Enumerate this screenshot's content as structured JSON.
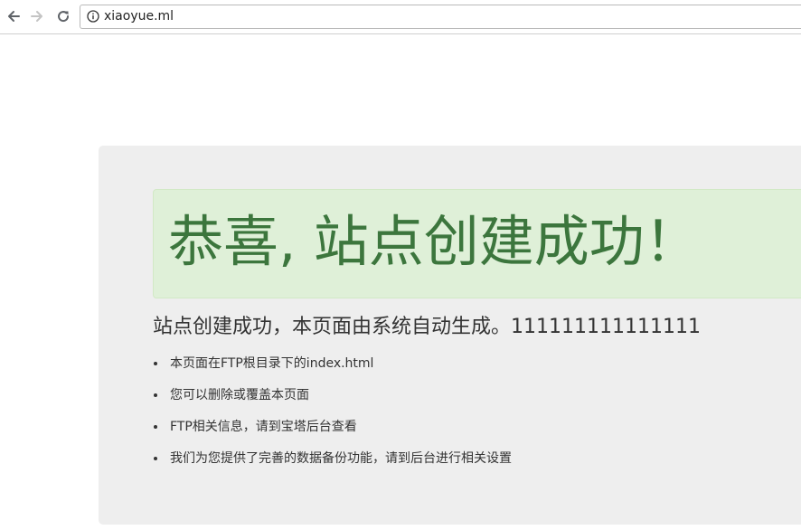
{
  "browser": {
    "url": "xiaoyue.ml",
    "back_icon": "arrow-left-icon",
    "forward_icon": "arrow-right-icon",
    "reload_icon": "reload-icon",
    "info_icon": "info-circle-icon"
  },
  "page": {
    "alert_heading": "恭喜, 站点创建成功！",
    "sub_heading": "站点创建成功，本页面由系统自动生成。111111111111111",
    "list_items": [
      "本页面在FTP根目录下的index.html",
      "您可以删除或覆盖本页面",
      "FTP相关信息，请到宝塔后台查看",
      "我们为您提供了完善的数据备份功能，请到后台进行相关设置"
    ]
  },
  "colors": {
    "alert_bg": "#dff0d8",
    "alert_text": "#3c763d",
    "panel_bg": "#eeeeee",
    "body_text": "#333333"
  }
}
